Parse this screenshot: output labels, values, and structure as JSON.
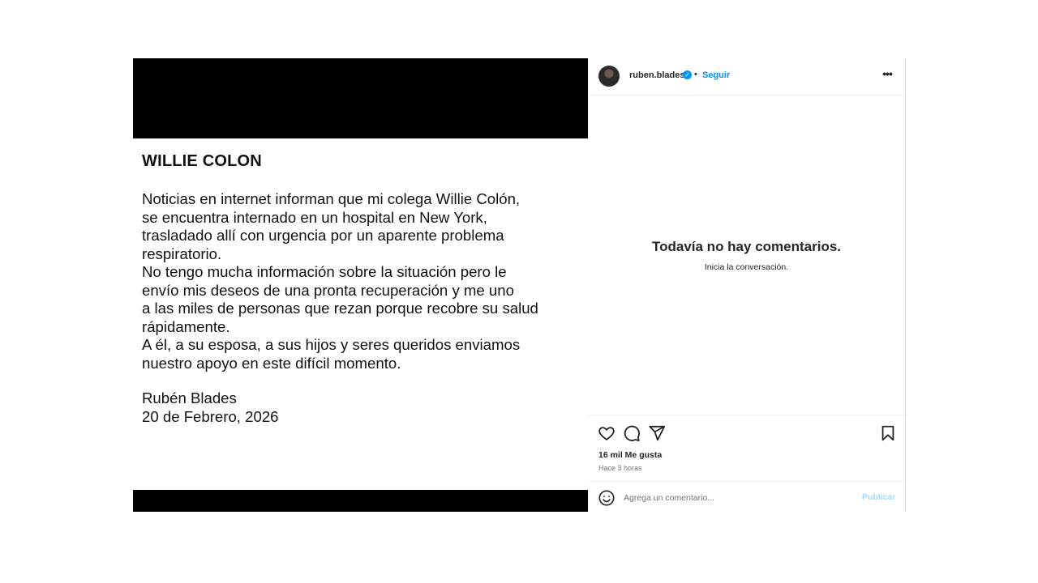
{
  "post": {
    "statement": {
      "title": "WILLIE COLON",
      "body_lines": [
        "Noticias en internet informan que mi colega Willie Colón,",
        "se encuentra internado en un hospital en New York,",
        "trasladado allí con urgencia por un aparente problema",
        "respiratorio.",
        "No tengo mucha información sobre la situación pero le",
        "envío mis deseos de una pronta recuperación y me uno",
        "a las miles de personas que rezan porque recobre su salud",
        "rápidamente.",
        "A él, a su esposa, a sus hijos y seres queridos enviamos",
        "nuestro apoyo en este difícil momento."
      ],
      "signature_lines": [
        "Rubén Blades",
        "20 de Febrero, 2026"
      ]
    }
  },
  "header": {
    "username": "ruben.blades",
    "verified_icon": "verified-badge-icon",
    "separator": "•",
    "follow_label": "Seguir",
    "more_label": "•••"
  },
  "comments": {
    "empty_title": "Todavía no hay comentarios.",
    "empty_subtitle": "Inicia la conversación."
  },
  "actions": {
    "icons": [
      "heart-icon",
      "comment-icon",
      "share-icon",
      "bookmark-icon"
    ],
    "likes": "16 mil Me gusta",
    "time": "Hace 3 horas"
  },
  "comment_box": {
    "emoji_icon": "emoji-icon",
    "placeholder": "Agrega un comentario...",
    "publish_label": "Publicar"
  },
  "colors": {
    "accent": "#0095f6",
    "publish_disabled": "#a8d8fb",
    "text": "#262626",
    "muted": "#737373"
  }
}
